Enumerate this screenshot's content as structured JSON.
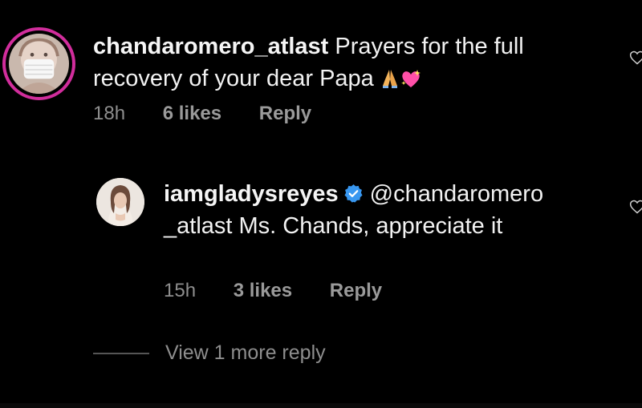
{
  "comment": {
    "username": "chandaromero_atlast",
    "text": "Prayers for the full recovery of your dear Papa",
    "emojis": [
      "folded-hands",
      "sparkling-heart"
    ],
    "time": "18h",
    "likes": "6 likes",
    "reply_label": "Reply"
  },
  "reply": {
    "username": "iamgladysreyes",
    "verified": true,
    "text": "@chandaromero _atlast Ms. Chands, appreciate it",
    "time": "15h",
    "likes": "3 likes",
    "reply_label": "Reply"
  },
  "view_more": "View 1 more reply",
  "colors": {
    "background": "#000000",
    "text": "#f2f2f2",
    "meta": "#8e8e8e",
    "story_ring": "#d12d9c",
    "verified": "#3897f0"
  }
}
